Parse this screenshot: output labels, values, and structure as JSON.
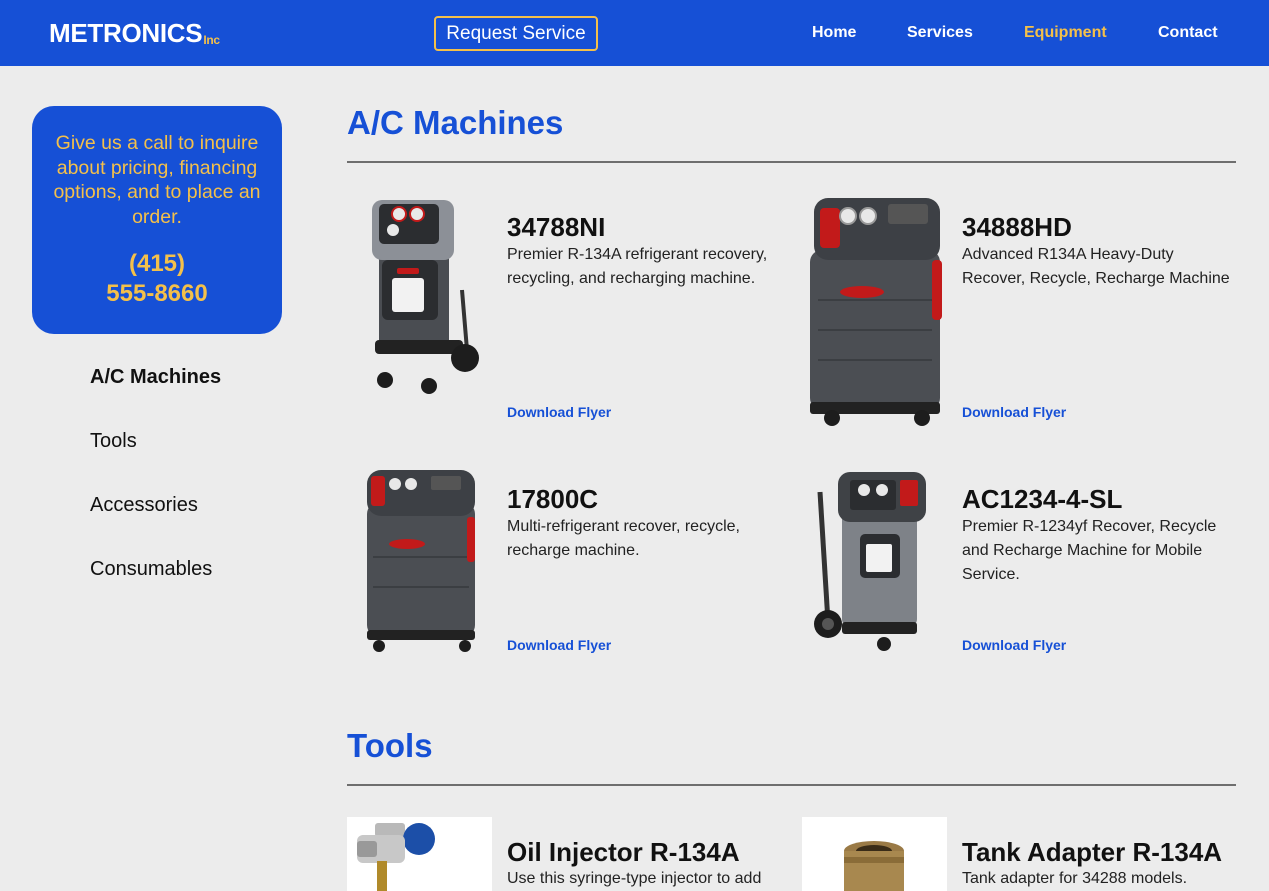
{
  "header": {
    "logo": "METRONICS",
    "logo_suffix": "Inc",
    "request_button": "Request Service",
    "nav": [
      "Home",
      "Services",
      "Equipment",
      "Contact"
    ],
    "active_nav": "Equipment"
  },
  "sidebar": {
    "call_text": "Give us a call to inquire about pricing, financing options, and to place an order.",
    "phone_line1": "(415)",
    "phone_line2": "555-8660",
    "links": [
      "A/C Machines",
      "Tools",
      "Accessories",
      "Consumables"
    ],
    "active_link": "A/C Machines"
  },
  "sections": [
    {
      "title": "A/C Machines",
      "products": [
        {
          "name": "34788NI",
          "description": "Premier R-134A refrigerant recovery, recycling, and recharging machine.",
          "link": "Download Flyer",
          "image": "ac-machine-image"
        },
        {
          "name": "34888HD",
          "description": "Advanced R134A Heavy-Duty Recover, Recycle, Recharge Machine",
          "link": "Download Flyer",
          "image": "ac-machine-image"
        },
        {
          "name": "17800C",
          "description": "Multi-refrigerant recover, recycle, recharge machine.",
          "link": "Download Flyer",
          "image": "ac-machine-image"
        },
        {
          "name": "AC1234-4-SL",
          "description": "Premier R-1234yf Recover, Recycle and Recharge Machine for Mobile Service.",
          "link": "Download Flyer",
          "image": "ac-machine-image"
        }
      ]
    },
    {
      "title": "Tools",
      "products": [
        {
          "name": "Oil Injector R-134A",
          "description": "Use this syringe-type injector to add",
          "image": "oil-injector-image"
        },
        {
          "name": "Tank Adapter R-134A",
          "description": "Tank adapter for 34288 models.",
          "image": "tank-adapter-image"
        }
      ]
    }
  ],
  "colors": {
    "brand_blue": "#1650d6",
    "accent_gold": "#f4c04a",
    "background": "#ececec"
  }
}
